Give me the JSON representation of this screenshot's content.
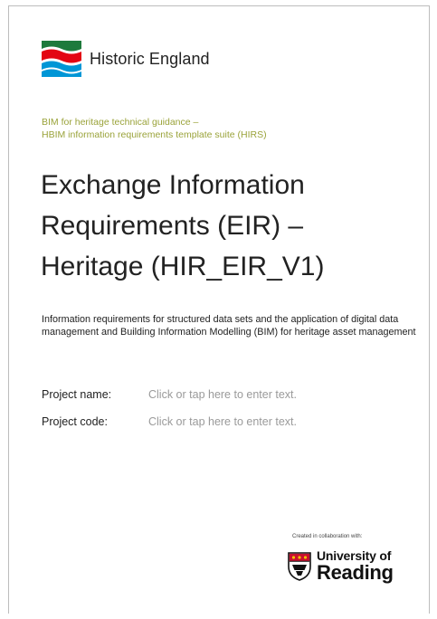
{
  "header": {
    "logo_text": "Historic England",
    "logo_colors": [
      "#1e7a3c",
      "#e30613",
      "#0096d6"
    ]
  },
  "subtitle": {
    "line1": "BIM for heritage technical guidance –",
    "line2": "HBIM information requirements template suite (HIRS)"
  },
  "title": {
    "line1": "Exchange Information",
    "line2": "Requirements (EIR) –",
    "line3": "Heritage (HIR_EIR_V1)"
  },
  "description": "Information requirements for structured data sets and the application of digital data management and Building Information Modelling (BIM) for heritage asset management",
  "fields": [
    {
      "label": "Project name:",
      "value": "Click or tap here to enter text."
    },
    {
      "label": "Project code:",
      "value": "Click or tap here to enter text."
    }
  ],
  "footer": {
    "collab_text": "Created in collaboration with:",
    "university_line1": "University of",
    "university_line2": "Reading"
  },
  "colors": {
    "accent_green": "#9aa33a",
    "placeholder_grey": "#9a9a9a"
  }
}
